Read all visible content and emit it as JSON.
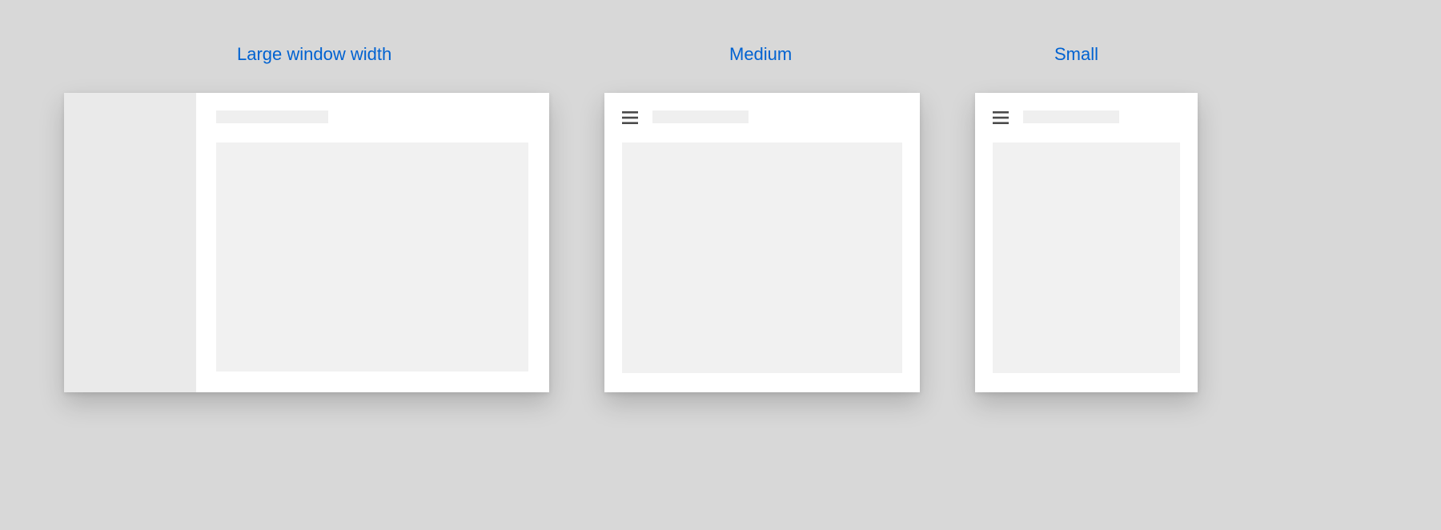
{
  "labels": {
    "large": "Large window width",
    "medium": "Medium",
    "small": "Small"
  },
  "colors": {
    "accent": "#0062d1",
    "page_bg": "#d8d8d8",
    "panel_bg": "#ffffff",
    "sidebar_bg": "#eaeaea",
    "placeholder_bg": "#f1f1f1",
    "icon": "#4a4a4a"
  },
  "icons": {
    "menu": "menu-icon"
  }
}
